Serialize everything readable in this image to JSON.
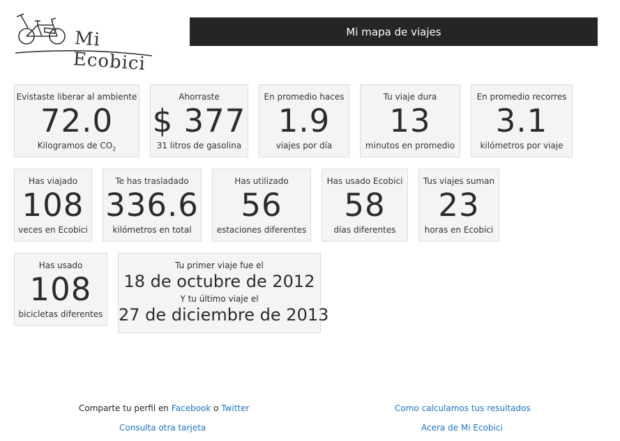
{
  "header": {
    "logo_text": "Mi Ecobici",
    "map_button_label": "Mi mapa de viajes"
  },
  "stats": {
    "co2": {
      "top": "Evistaste liberar al ambiente",
      "value": "72.0",
      "bottom": "Kilogramos de CO",
      "bottom_sub": "2"
    },
    "savings": {
      "top": "Ahorraste",
      "value": "$ 377",
      "bottom": "31 litros de gasolina"
    },
    "trips_per_day": {
      "top": "En promedio haces",
      "value": "1.9",
      "bottom": "viajes por día"
    },
    "trip_duration": {
      "top": "Tu viaje dura",
      "value": "13",
      "bottom": "minutos en promedio"
    },
    "avg_distance": {
      "top": "En promedio recorres",
      "value": "3.1",
      "bottom": "kilómetros por viaje"
    },
    "trips": {
      "top": "Has viajado",
      "value": "108",
      "bottom": "veces en Ecobici"
    },
    "distance": {
      "top": "Te has trasladado",
      "value": "336.6",
      "bottom": "kilómetros en total"
    },
    "stations": {
      "top": "Has utilizado",
      "value": "56",
      "bottom": "estaciones diferentes"
    },
    "days": {
      "top": "Has usado Ecobici",
      "value": "58",
      "bottom": "días diferentes"
    },
    "hours": {
      "top": "Tus viajes suman",
      "value": "23",
      "bottom": "horas en Ecobici"
    },
    "bikes": {
      "top": "Has usado",
      "value": "108",
      "bottom": "bicicletas diferentes"
    }
  },
  "dates": {
    "first_label": "Tu primer viaje fue el",
    "first_date": "18 de octubre de 2012",
    "last_label": "Y tu último viaje el",
    "last_date": "27 de diciembre de 2013"
  },
  "footer": {
    "share_prefix": "Comparte tu perfil en",
    "facebook": "Facebook",
    "or": "o",
    "twitter": "Twitter",
    "other_card": "Consulta otra tarjeta",
    "how_calculated": "Como calculamos tus resultados",
    "about": "Acera de Mi Ecobici"
  }
}
